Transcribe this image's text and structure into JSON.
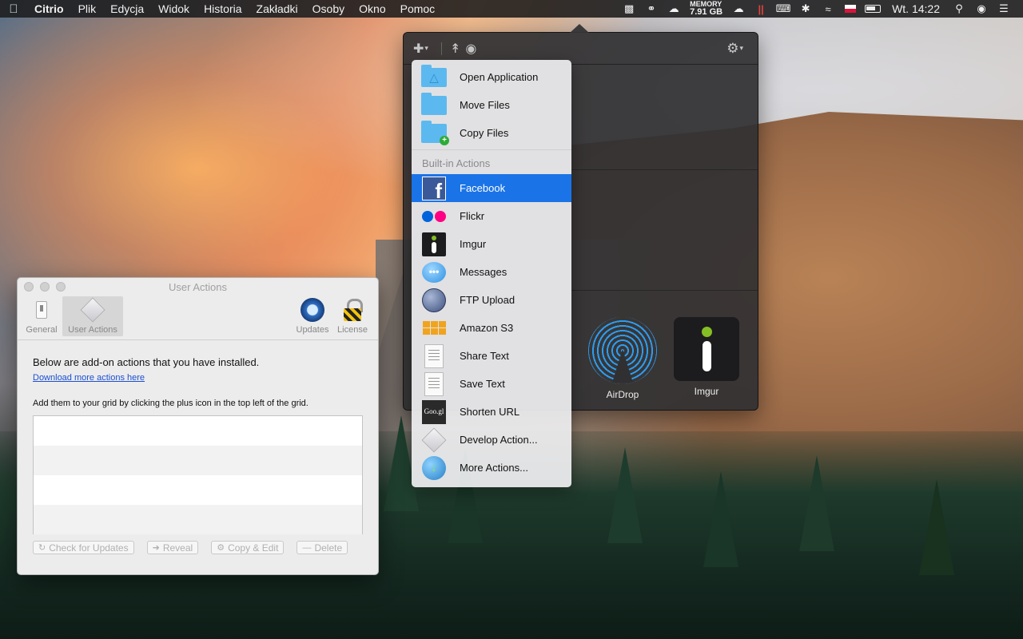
{
  "menubar": {
    "app_name": "Citrio",
    "items": [
      "Plik",
      "Edycja",
      "Widok",
      "Historia",
      "Zakładki",
      "Osoby",
      "Okno",
      "Pomoc"
    ],
    "memory_label": "MEMORY",
    "memory_value": "7.91 GB",
    "clock": "Wt. 14:22"
  },
  "dropmenu": {
    "top_items": [
      {
        "label": "Open Application",
        "icon": "app-folder-icon"
      },
      {
        "label": "Move Files",
        "icon": "folder-icon"
      },
      {
        "label": "Copy Files",
        "icon": "folder-plus-icon"
      }
    ],
    "section_header": "Built-in Actions",
    "builtin_items": [
      {
        "label": "Facebook",
        "icon": "facebook-icon",
        "selected": true
      },
      {
        "label": "Flickr",
        "icon": "flickr-icon"
      },
      {
        "label": "Imgur",
        "icon": "imgur-icon"
      },
      {
        "label": "Messages",
        "icon": "messages-icon"
      },
      {
        "label": "FTP Upload",
        "icon": "globe-icon"
      },
      {
        "label": "Amazon S3",
        "icon": "amazon-s3-icon"
      },
      {
        "label": "Share Text",
        "icon": "text-document-icon"
      },
      {
        "label": "Save Text",
        "icon": "text-document-icon"
      },
      {
        "label": "Shorten URL",
        "icon": "googl-icon"
      },
      {
        "label": "Develop Action...",
        "icon": "cube-icon"
      },
      {
        "label": "More Actions...",
        "icon": "download-globe-icon"
      }
    ],
    "accent_color": "#1a74e8"
  },
  "popover": {
    "tiles": [
      {
        "label": "AirDrop",
        "icon": "airdrop-icon"
      },
      {
        "label": "Imgur",
        "icon": "imgur-icon"
      }
    ]
  },
  "prefs": {
    "window_title": "User Actions",
    "tabs": [
      {
        "label": "General",
        "icon": "switch-icon"
      },
      {
        "label": "User Actions",
        "icon": "cube-icon",
        "active": true
      },
      {
        "label": "Updates",
        "icon": "updates-icon"
      },
      {
        "label": "License",
        "icon": "lock-icon"
      }
    ],
    "intro": "Below are add-on actions that you have installed.",
    "download_link": "Download more actions here",
    "hint": "Add them to your grid by clicking the plus icon in the top left of the grid.",
    "buttons": {
      "check": "Check for Updates",
      "reveal": "Reveal",
      "copy_edit": "Copy & Edit",
      "delete": "Delete"
    }
  }
}
